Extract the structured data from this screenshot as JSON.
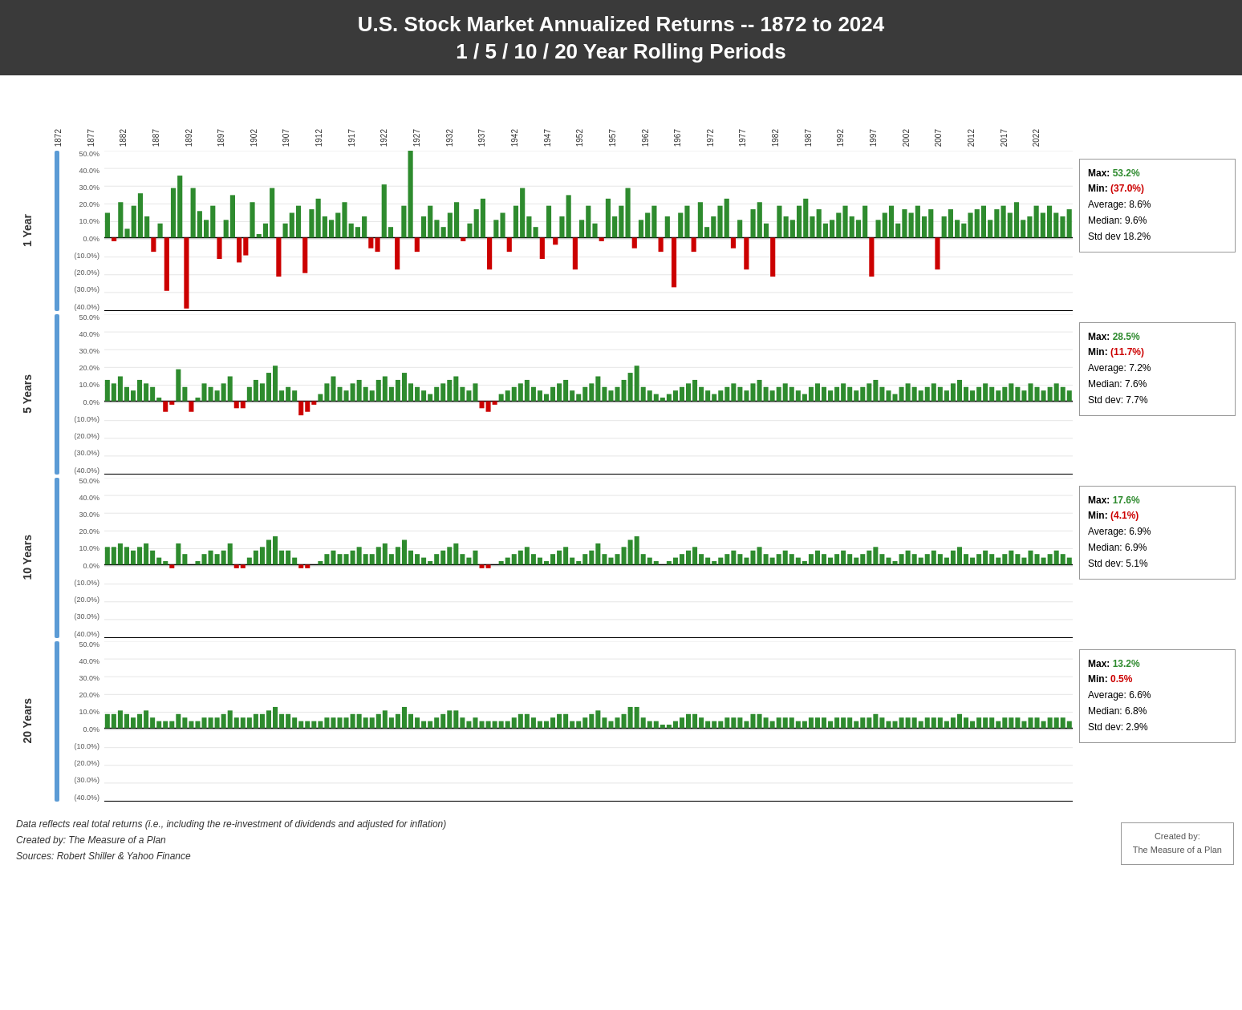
{
  "header": {
    "line1": "U.S. Stock Market Annualized Returns -- 1872 to 2024",
    "line2": "1 / 5 / 10 / 20 Year Rolling Periods"
  },
  "years": [
    "1872",
    "1877",
    "1882",
    "1887",
    "1892",
    "1897",
    "1902",
    "1907",
    "1912",
    "1917",
    "1922",
    "1927",
    "1932",
    "1937",
    "1942",
    "1947",
    "1952",
    "1957",
    "1962",
    "1967",
    "1972",
    "1977",
    "1982",
    "1987",
    "1992",
    "1997",
    "2002",
    "2007",
    "2012",
    "2017",
    "2022"
  ],
  "sections": [
    {
      "id": "1year",
      "label": "1 Year",
      "stats": {
        "max_label": "Max:",
        "max_val": "53.2%",
        "min_label": "Min:",
        "min_val": "(37.0%)",
        "avg": "Average: 8.6%",
        "median": "Median: 9.6%",
        "std": "Std dev 18.2%"
      },
      "y_labels": [
        "50.0%",
        "40.0%",
        "30.0%",
        "20.0%",
        "10.0%",
        "0.0%",
        "(10.0%)",
        "(20.0%)",
        "(30.0%)",
        "(40.0%)"
      ],
      "zero_pct": 0.545
    },
    {
      "id": "5year",
      "label": "5 Years",
      "stats": {
        "max_label": "Max:",
        "max_val": "28.5%",
        "min_label": "Min:",
        "min_val": "(11.7%)",
        "avg": "Average: 7.2%",
        "median": "Median: 7.6%",
        "std": "Std dev: 7.7%"
      },
      "y_labels": [
        "50.0%",
        "40.0%",
        "30.0%",
        "20.0%",
        "10.0%",
        "0.0%",
        "(10.0%)",
        "(20.0%)",
        "(30.0%)",
        "(40.0%)"
      ],
      "zero_pct": 0.545
    },
    {
      "id": "10year",
      "label": "10 Years",
      "stats": {
        "max_label": "Max:",
        "max_val": "17.6%",
        "min_label": "Min:",
        "min_val": "(4.1%)",
        "avg": "Average: 6.9%",
        "median": "Median: 6.9%",
        "std": "Std dev: 5.1%"
      },
      "y_labels": [
        "50.0%",
        "40.0%",
        "30.0%",
        "20.0%",
        "10.0%",
        "0.0%",
        "(10.0%)",
        "(20.0%)",
        "(30.0%)",
        "(40.0%)"
      ],
      "zero_pct": 0.545
    },
    {
      "id": "20year",
      "label": "20 Years",
      "stats": {
        "max_label": "Max:",
        "max_val": "13.2%",
        "min_label": "Min:",
        "min_val": "0.5%",
        "avg": "Average: 6.6%",
        "median": "Median: 6.8%",
        "std": "Std dev: 2.9%"
      },
      "y_labels": [
        "50.0%",
        "40.0%",
        "30.0%",
        "20.0%",
        "10.0%",
        "0.0%",
        "(10.0%)",
        "(20.0%)",
        "(30.0%)",
        "(40.0%)"
      ],
      "zero_pct": 0.545
    }
  ],
  "footer": {
    "note1": "Data reflects real total returns (i.e., including the re-investment of dividends and adjusted for inflation)",
    "note2": "Created by: The Measure of a Plan",
    "note3": "Sources: Robert Shiller & Yahoo Finance",
    "credit_line1": "Created by:",
    "credit_line2": "The Measure of a Plan"
  }
}
